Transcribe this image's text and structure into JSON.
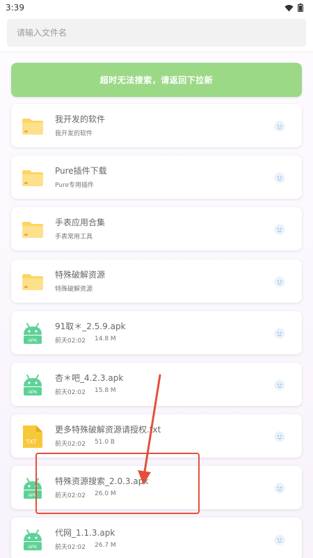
{
  "status_bar": {
    "time": "3:39"
  },
  "search": {
    "placeholder": "请输入文件名",
    "value": ""
  },
  "banner": {
    "text": "超时无法搜索，请返回下拉新"
  },
  "items": [
    {
      "kind": "folder",
      "title": "我开发的软件",
      "subtitle": "我开发的软件"
    },
    {
      "kind": "folder",
      "title": "Pure插件下载",
      "subtitle": "Pure专用插件"
    },
    {
      "kind": "folder",
      "title": "手表应用合集",
      "subtitle": "手表常用工具"
    },
    {
      "kind": "folder",
      "title": "特殊破解资源",
      "subtitle": "特殊破解资源"
    },
    {
      "kind": "apk",
      "title": "91取＊_2.5.9.apk",
      "date": "前天02:02",
      "size": "14.8 M",
      "icon_label": "APK"
    },
    {
      "kind": "apk",
      "title": "杏＊吧_4.2.3.apk",
      "date": "前天02:02",
      "size": "15.8 M",
      "icon_label": "APK"
    },
    {
      "kind": "txt",
      "title": "更多特殊破解资源请授权.txt",
      "date": "前天02:02",
      "size": "51.0 B",
      "icon_label": "TXT"
    },
    {
      "kind": "apk",
      "title": "特殊资源搜索_2.0.3.apk",
      "date": "前天02:02",
      "size": "26.0 M",
      "icon_label": "APK"
    },
    {
      "kind": "apk",
      "title": "代网_1.1.3.apk",
      "date": "前天02:02",
      "size": "26.7 M",
      "icon_label": "APK"
    }
  ],
  "colors": {
    "banner": "#9bd987",
    "folder": "#fcd565",
    "android": "#5ed296",
    "txt": "#f6c83a",
    "annotation": "#e44f3c"
  }
}
